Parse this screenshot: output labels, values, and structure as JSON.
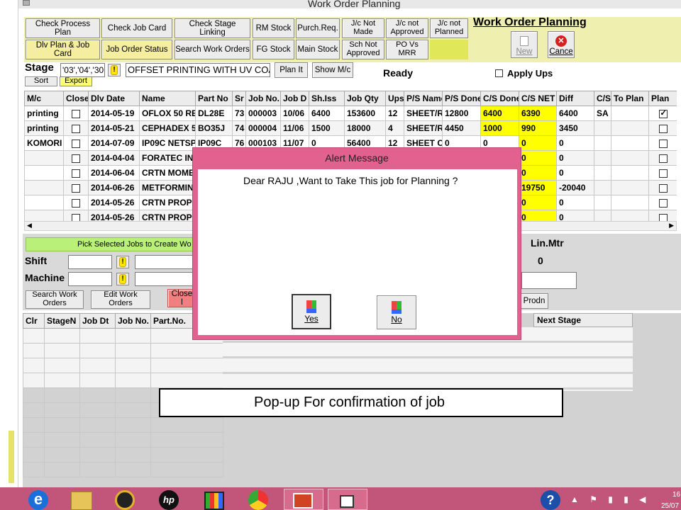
{
  "window": {
    "title": "Work Order Planning"
  },
  "toolbar": {
    "row1": [
      "Check Process Plan",
      "Check Job Card",
      "Check Stage Linking",
      "RM Stock",
      "Purch.Req."
    ],
    "row2": [
      "Dlv Plan & Job Card",
      "Job Order Status",
      "Search Work Orders",
      "FG Stock",
      "Main Stock"
    ],
    "status_buttons": [
      {
        "l1": "J/c Not",
        "l2": "Made"
      },
      {
        "l1": "J/c not",
        "l2": "Approved"
      },
      {
        "l1": "J/c not",
        "l2": "Planned"
      },
      {
        "l1": "Sch Not",
        "l2": "Approved"
      },
      {
        "l1": "PO Vs",
        "l2": "MRR"
      }
    ],
    "heading": "Work Order Planning",
    "new_label": "New",
    "cancel_label": "Cance"
  },
  "stage": {
    "label": "Stage",
    "sort": "Sort",
    "export": "Export",
    "value": "'03','04','30",
    "process": "OFFSET PRINTING WITH UV COAT",
    "plan_it": "Plan It",
    "show_mc": "Show M/c",
    "status": "Ready",
    "apply_ups": "Apply Ups"
  },
  "grid": {
    "headers": [
      "M/c",
      "Close",
      "Dlv Date",
      "Name",
      "Part No",
      "Sr",
      "Job No.",
      "Job D",
      "Sh.Iss",
      "Job Qty",
      "Ups",
      "P/S Name",
      "P/S Done",
      "C/S Done",
      "C/S NET",
      "Diff",
      "C/S",
      "To Plan",
      "Plan"
    ],
    "rows": [
      {
        "mc": "printing",
        "dlv": "2014-05-19",
        "name": "OFLOX 50 RE",
        "part": "DL28E",
        "sr": "73",
        "job": "000003",
        "jobd": "10/06",
        "shiss": "6400",
        "qty": "153600",
        "ups": "12",
        "ps": "SHEET/R",
        "psd": "12800",
        "csd": "6400",
        "csnet": "6390",
        "diff": "6400",
        "cs": "SA",
        "plan": true
      },
      {
        "mc": "printing",
        "dlv": "2014-05-21",
        "name": "CEPHADEX 5",
        "part": "BO35J",
        "sr": "74",
        "job": "000004",
        "jobd": "11/06",
        "shiss": "1500",
        "qty": "18000",
        "ups": "4",
        "ps": "SHEET/R",
        "psd": "4450",
        "csd": "1000",
        "csnet": "990",
        "diff": "3450",
        "cs": "",
        "plan": false
      },
      {
        "mc": "KOMORI",
        "dlv": "2014-07-09",
        "name": "IP09C NETSP",
        "part": "IP09C",
        "sr": "76",
        "job": "000103",
        "jobd": "11/07",
        "shiss": "0",
        "qty": "56400",
        "ups": "12",
        "ps": "SHEET C",
        "psd": "0",
        "csd": "0",
        "csnet": "0",
        "diff": "0",
        "cs": "",
        "plan": false
      },
      {
        "mc": "",
        "dlv": "2014-04-04",
        "name": "FORATEC INH",
        "part": "",
        "sr": "",
        "job": "",
        "jobd": "",
        "shiss": "",
        "qty": "",
        "ups": "",
        "ps": "",
        "psd": "",
        "csd": "",
        "csnet": "0",
        "diff": "0",
        "cs": "",
        "plan": false
      },
      {
        "mc": "",
        "dlv": "2014-06-04",
        "name": "CRTN MOME",
        "part": "",
        "sr": "",
        "job": "",
        "jobd": "",
        "shiss": "",
        "qty": "",
        "ups": "",
        "ps": "",
        "psd": "",
        "csd": "",
        "csnet": "0",
        "diff": "0",
        "cs": "",
        "plan": false
      },
      {
        "mc": "",
        "dlv": "2014-06-26",
        "name": "METFORMIN",
        "part": "",
        "sr": "",
        "job": "",
        "jobd": "",
        "shiss": "",
        "qty": "",
        "ups": "",
        "ps": "",
        "psd": "",
        "csd": "",
        "csnet": "19750",
        "diff": "-20040",
        "cs": "",
        "plan": false
      },
      {
        "mc": "",
        "dlv": "2014-05-26",
        "name": "CRTN PROPO",
        "part": "",
        "sr": "",
        "job": "",
        "jobd": "",
        "shiss": "",
        "qty": "",
        "ups": "",
        "ps": "",
        "psd": "",
        "csd": "",
        "csnet": "0",
        "diff": "0",
        "cs": "",
        "plan": false
      },
      {
        "mc": "",
        "dlv": "2014-05-26",
        "name": "CRTN PROPO",
        "part": "",
        "sr": "",
        "job": "",
        "jobd": "",
        "shiss": "",
        "qty": "",
        "ups": "",
        "ps": "",
        "psd": "",
        "csd": "",
        "csnet": "0",
        "diff": "0",
        "cs": "",
        "plan": false
      }
    ]
  },
  "lower": {
    "pick_label": "Pick Selected Jobs to Create  Wo",
    "shift_label": "Shift",
    "machine_label": "Machine",
    "search_l1": "Search Work",
    "search_l2": "Orders",
    "edit_l1": "Edit Work",
    "edit_l2": "Orders",
    "close_label": "Close I",
    "lin_mtr_label": "Lin.Mtr",
    "lin_mtr_value": "0",
    "prodn_label": "Prodn",
    "headers": [
      "Clr",
      "StageN",
      "Job Dt",
      "Job No.",
      "Part.No."
    ],
    "next_stage": "Next Stage"
  },
  "dialog": {
    "title": "Alert Message",
    "message": "Dear RAJU ,Want to Take This job for Planning ?",
    "yes": "Yes",
    "no": "No"
  },
  "caption": "Pop-up For confirmation of job",
  "tray": {
    "time": "16",
    "date": "25/07"
  },
  "colors": {
    "highlight": "#ffff00",
    "panel": "#efefb0",
    "dialog_frame": "#e3618e",
    "taskbar": "#c2567a"
  }
}
